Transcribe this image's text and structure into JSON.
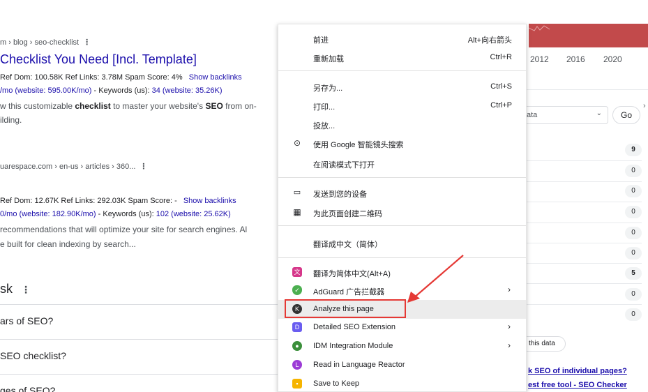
{
  "results": [
    {
      "breadcrumb": "m › blog › seo-checklist",
      "title": "Checklist You Need [Incl. Template]",
      "metrics_text": "Ref Dom: 100.58K   Ref Links: 3.78M   Spam Score: 4%",
      "metrics_link": "Show backlinks",
      "traffic_a": "/mo (website: 595.00K/mo)",
      "traffic_b": " - Keywords (us): ",
      "traffic_c": "34 (website: 35.26K)",
      "snippet_1a": "w this customizable ",
      "snippet_1b": "checklist",
      "snippet_1c": " to master your website's ",
      "snippet_1d": "SEO",
      "snippet_1e": " from on-",
      "snippet_2": "ilding."
    },
    {
      "breadcrumb": "uarespace.com › en-us › articles › 360...",
      "metrics_text": "Ref Dom: 12.67K   Ref Links: 292.03K   Spam Score: -",
      "metrics_link": "Show backlinks",
      "traffic_a": "0/mo (website: 182.90K/mo)",
      "traffic_b": " - Keywords (us): ",
      "traffic_c": "102 (website: 25.62K)",
      "snippet_1": " recommendations that will optimize your site for search engines. Al",
      "snippet_2": "e built for clean indexing by search..."
    }
  ],
  "paa": {
    "heading": "sk",
    "items": [
      "ars of SEO?",
      " SEO checklist?",
      "ges of SEO?"
    ]
  },
  "right_panel": {
    "years": [
      "2012",
      "2016",
      "2020"
    ],
    "select_value": "ata",
    "go_label": "Go",
    "counts": [
      {
        "v": "9",
        "bold": true
      },
      {
        "v": "0",
        "bold": false
      },
      {
        "v": "0",
        "bold": false
      },
      {
        "v": "0",
        "bold": false
      },
      {
        "v": "0",
        "bold": false
      },
      {
        "v": "0",
        "bold": false
      },
      {
        "v": "5",
        "bold": true
      },
      {
        "v": "0",
        "bold": false
      },
      {
        "v": "0",
        "bold": false
      }
    ],
    "pill_label": "this data",
    "link_1": "k SEO of individual pages?",
    "link_2": "est free tool - SEO Checker"
  },
  "menu": {
    "back": {
      "label": "前进",
      "shortcut": "Alt+向右箭头"
    },
    "reload": {
      "label": "重新加载",
      "shortcut": "Ctrl+R"
    },
    "save_as": {
      "label": "另存为...",
      "shortcut": "Ctrl+S"
    },
    "print": {
      "label": "打印...",
      "shortcut": "Ctrl+P"
    },
    "cast": {
      "label": "投放..."
    },
    "lens": {
      "label": "使用 Google 智能镜头搜索"
    },
    "reader": {
      "label": "在阅读模式下打开"
    },
    "send_device": {
      "label": "发送到您的设备"
    },
    "qr": {
      "label": "为此页面创建二维码"
    },
    "translate": {
      "label": "翻译成中文（简体）"
    },
    "translate_ext": {
      "label": "翻译为简体中文(Alt+A)"
    },
    "adguard": {
      "label": "AdGuard 广告拦截器"
    },
    "analyze": {
      "label": "Analyze this page"
    },
    "detailed_seo": {
      "label": "Detailed SEO Extension"
    },
    "idm": {
      "label": "IDM Integration Module"
    },
    "language_reactor": {
      "label": "Read in Language Reactor"
    },
    "keep": {
      "label": "Save to Keep"
    }
  },
  "colors": {
    "link": "#1a0dab",
    "banner": "#c24a4b",
    "annotation": "#e53935"
  }
}
